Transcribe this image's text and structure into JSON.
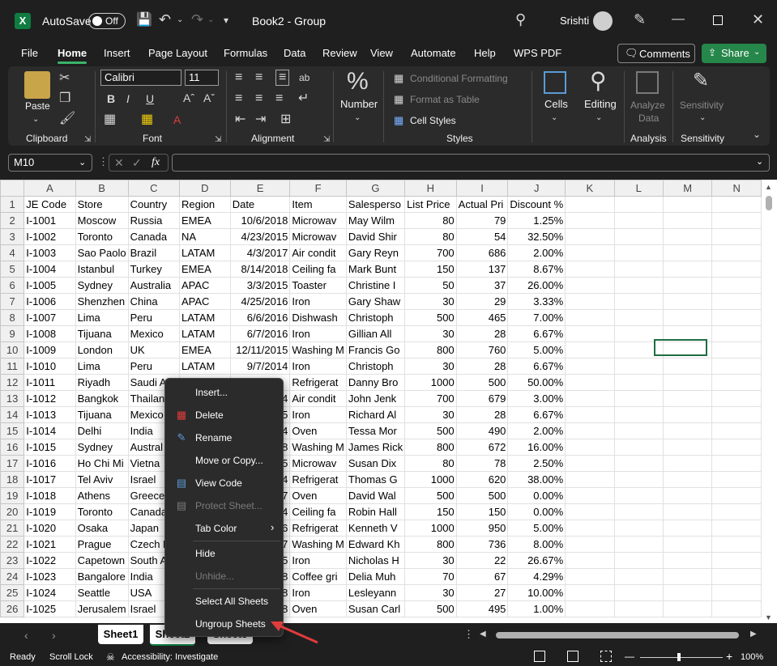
{
  "titlebar": {
    "app_letter": "X",
    "autosave_label": "AutoSave",
    "autosave_state": "Off",
    "document_title": "Book2 - Group",
    "user_name": "Srishti"
  },
  "tabs": [
    "File",
    "Home",
    "Insert",
    "Page Layout",
    "Formulas",
    "Data",
    "Review",
    "View",
    "Automate",
    "Help",
    "WPS PDF"
  ],
  "active_tab": "Home",
  "actions": {
    "comments": "Comments",
    "share": "Share"
  },
  "ribbon": {
    "clipboard": {
      "paste": "Paste",
      "label": "Clipboard"
    },
    "font": {
      "family": "Calibri",
      "size": "11",
      "label": "Font"
    },
    "alignment": {
      "label": "Alignment"
    },
    "number": {
      "label": "Number",
      "symbol": "%"
    },
    "styles": {
      "conditional": "Conditional Formatting",
      "format_table": "Format as Table",
      "cell_styles": "Cell Styles",
      "label": "Styles"
    },
    "cells": {
      "label": "Cells"
    },
    "editing": {
      "label": "Editing"
    },
    "analysis": {
      "btn1": "Analyze",
      "btn2": "Data",
      "label": "Analysis"
    },
    "sensitivity": {
      "btn": "Sensitivity",
      "label": "Sensitivity"
    }
  },
  "formula": {
    "namebox": "M10",
    "fx": "fx",
    "value": ""
  },
  "columns": [
    "A",
    "B",
    "C",
    "D",
    "E",
    "F",
    "G",
    "H",
    "I",
    "J",
    "K",
    "L",
    "M",
    "N"
  ],
  "header_row": [
    "JE Code",
    "Store",
    "Country",
    "Region",
    "Date",
    "Item",
    "Salesperso",
    "List Price",
    "Actual Pri",
    "Discount %",
    "",
    "",
    "",
    ""
  ],
  "rows": [
    [
      "I-1001",
      "Moscow",
      "Russia",
      "EMEA",
      "10/6/2018",
      "Microwav",
      "May Wilm",
      "80",
      "79",
      "1.25%"
    ],
    [
      "I-1002",
      "Toronto",
      "Canada",
      "NA",
      "4/23/2015",
      "Microwav",
      "David Shir",
      "80",
      "54",
      "32.50%"
    ],
    [
      "I-1003",
      "Sao Paolo",
      "Brazil",
      "LATAM",
      "4/3/2017",
      "Air condit",
      "Gary Reyn",
      "700",
      "686",
      "2.00%"
    ],
    [
      "I-1004",
      "Istanbul",
      "Turkey",
      "EMEA",
      "8/14/2018",
      "Ceiling fa",
      "Mark Bunt",
      "150",
      "137",
      "8.67%"
    ],
    [
      "I-1005",
      "Sydney",
      "Australia",
      "APAC",
      "3/3/2015",
      "Toaster",
      "Christine I",
      "50",
      "37",
      "26.00%"
    ],
    [
      "I-1006",
      "Shenzhen",
      "China",
      "APAC",
      "4/25/2016",
      "Iron",
      "Gary Shaw",
      "30",
      "29",
      "3.33%"
    ],
    [
      "I-1007",
      "Lima",
      "Peru",
      "LATAM",
      "6/6/2016",
      "Dishwash",
      "Christoph",
      "500",
      "465",
      "7.00%"
    ],
    [
      "I-1008",
      "Tijuana",
      "Mexico",
      "LATAM",
      "6/7/2016",
      "Iron",
      "Gillian All",
      "30",
      "28",
      "6.67%"
    ],
    [
      "I-1009",
      "London",
      "UK",
      "EMEA",
      "12/11/2015",
      "Washing M",
      "Francis Go",
      "800",
      "760",
      "5.00%"
    ],
    [
      "I-1010",
      "Lima",
      "Peru",
      "LATAM",
      "9/7/2014",
      "Iron",
      "Christoph",
      "30",
      "28",
      "6.67%"
    ],
    [
      "I-1011",
      "Riyadh",
      "Saudi A",
      "EMEA",
      "",
      "Refrigerat",
      "Danny Bro",
      "1000",
      "500",
      "50.00%"
    ],
    [
      "I-1012",
      "Bangkok",
      "Thailan",
      "",
      "4",
      "Air condit",
      "John Jenk",
      "700",
      "679",
      "3.00%"
    ],
    [
      "I-1013",
      "Tijuana",
      "Mexico",
      "",
      "5",
      "Iron",
      "Richard Al",
      "30",
      "28",
      "6.67%"
    ],
    [
      "I-1014",
      "Delhi",
      "India",
      "",
      "4",
      "Oven",
      "Tessa Mor",
      "500",
      "490",
      "2.00%"
    ],
    [
      "I-1015",
      "Sydney",
      "Austral",
      "",
      "8",
      "Washing M",
      "James Rick",
      "800",
      "672",
      "16.00%"
    ],
    [
      "I-1016",
      "Ho Chi Mi",
      "Vietna",
      "",
      "5",
      "Microwav",
      "Susan Dix",
      "80",
      "78",
      "2.50%"
    ],
    [
      "I-1017",
      "Tel Aviv",
      "Israel",
      "",
      "4",
      "Refrigerat",
      "Thomas G",
      "1000",
      "620",
      "38.00%"
    ],
    [
      "I-1018",
      "Athens",
      "Greece",
      "",
      "7",
      "Oven",
      "David Wal",
      "500",
      "500",
      "0.00%"
    ],
    [
      "I-1019",
      "Toronto",
      "Canada",
      "",
      "4",
      "Ceiling fa",
      "Robin Hall",
      "150",
      "150",
      "0.00%"
    ],
    [
      "I-1020",
      "Osaka",
      "Japan",
      "",
      "6",
      "Refrigerat",
      "Kenneth V",
      "1000",
      "950",
      "5.00%"
    ],
    [
      "I-1021",
      "Prague",
      "Czech F",
      "",
      "7",
      "Washing M",
      "Edward Kh",
      "800",
      "736",
      "8.00%"
    ],
    [
      "I-1022",
      "Capetown",
      "South A",
      "",
      "5",
      "Iron",
      "Nicholas H",
      "30",
      "22",
      "26.67%"
    ],
    [
      "I-1023",
      "Bangalore",
      "India",
      "",
      "8",
      "Coffee gri",
      "Delia Muh",
      "70",
      "67",
      "4.29%"
    ],
    [
      "I-1024",
      "Seattle",
      "USA",
      "",
      "8",
      "Iron",
      "Lesleyann",
      "30",
      "27",
      "10.00%"
    ],
    [
      "I-1025",
      "Jerusalem",
      "Israel",
      "",
      "8",
      "Oven",
      "Susan Carl",
      "500",
      "495",
      "1.00%"
    ]
  ],
  "context_menu": [
    {
      "label": "Insert...",
      "icon": "",
      "disabled": false
    },
    {
      "label": "Delete",
      "icon": "delete-sheet-icon",
      "disabled": false
    },
    {
      "label": "Rename",
      "icon": "rename-icon",
      "disabled": false
    },
    {
      "label": "Move or Copy...",
      "icon": "",
      "disabled": false
    },
    {
      "label": "View Code",
      "icon": "view-code-icon",
      "disabled": false
    },
    {
      "label": "Protect Sheet...",
      "icon": "protect-sheet-icon",
      "disabled": true
    },
    {
      "label": "Tab Color",
      "icon": "",
      "disabled": false
    },
    {
      "label": "Hide",
      "icon": "",
      "disabled": false
    },
    {
      "label": "Unhide...",
      "icon": "",
      "disabled": true
    },
    {
      "label": "Select All Sheets",
      "icon": "",
      "disabled": false
    },
    {
      "label": "Ungroup Sheets",
      "icon": "",
      "disabled": false
    }
  ],
  "sheets": [
    "Sheet1",
    "Sheet2",
    "Sheet3"
  ],
  "status": {
    "ready": "Ready",
    "scroll_lock": "Scroll Lock",
    "accessibility": "Accessibility: Investigate",
    "zoom": "100%"
  },
  "colors": {
    "excel_green": "#107c41",
    "share_green": "#26874a",
    "annotation_arrow": "#e03c3c"
  }
}
